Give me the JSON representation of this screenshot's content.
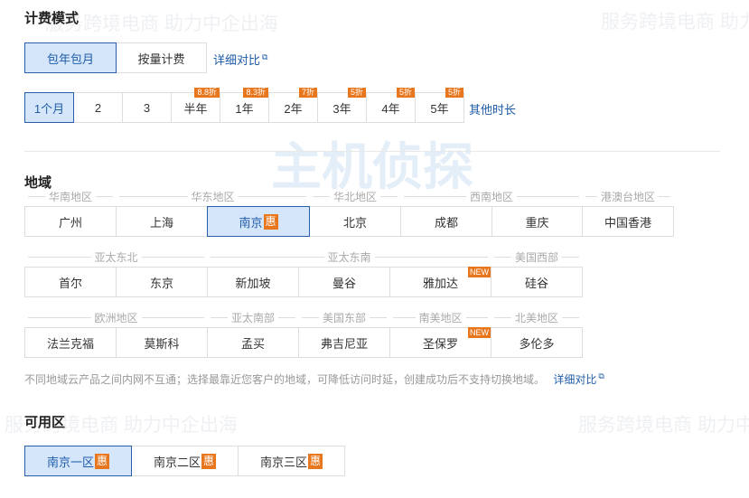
{
  "watermark": {
    "slogan": "服务跨境电商 助力中企出海",
    "logo": "主机侦探"
  },
  "billing": {
    "title": "计费模式",
    "options": [
      "包年包月",
      "按量计费"
    ],
    "selected": 0,
    "compare_link": "详细对比"
  },
  "duration": {
    "options": [
      {
        "label": "1个月"
      },
      {
        "label": "2"
      },
      {
        "label": "3"
      },
      {
        "label": "半年",
        "badge": "8.8折"
      },
      {
        "label": "1年",
        "badge": "8.3折"
      },
      {
        "label": "2年",
        "badge": "7折"
      },
      {
        "label": "3年",
        "badge": "5折"
      },
      {
        "label": "4年",
        "badge": "5折"
      },
      {
        "label": "5年",
        "badge": "5折"
      }
    ],
    "selected": 0,
    "other_link": "其他时长"
  },
  "region": {
    "title": "地域",
    "rows": [
      [
        {
          "group": "华南地区",
          "items": [
            {
              "label": "广州"
            }
          ]
        },
        {
          "group": "华东地区",
          "items": [
            {
              "label": "上海"
            },
            {
              "label": "南京",
              "hui": "惠",
              "selected": true
            }
          ]
        },
        {
          "group": "华北地区",
          "items": [
            {
              "label": "北京"
            }
          ]
        },
        {
          "group": "西南地区",
          "items": [
            {
              "label": "成都"
            },
            {
              "label": "重庆"
            }
          ]
        },
        {
          "group": "港澳台地区",
          "items": [
            {
              "label": "中国香港"
            }
          ]
        }
      ],
      [
        {
          "group": "亚太东北",
          "items": [
            {
              "label": "首尔"
            },
            {
              "label": "东京"
            }
          ]
        },
        {
          "group": "亚太东南",
          "items": [
            {
              "label": "新加坡"
            },
            {
              "label": "曼谷"
            },
            {
              "label": "雅加达",
              "new": "NEW"
            }
          ]
        },
        {
          "group": "美国西部",
          "items": [
            {
              "label": "硅谷"
            }
          ]
        }
      ],
      [
        {
          "group": "欧洲地区",
          "items": [
            {
              "label": "法兰克福"
            },
            {
              "label": "莫斯科"
            }
          ]
        },
        {
          "group": "亚太南部",
          "items": [
            {
              "label": "孟买"
            }
          ]
        },
        {
          "group": "美国东部",
          "items": [
            {
              "label": "弗吉尼亚"
            }
          ]
        },
        {
          "group": "南美地区",
          "items": [
            {
              "label": "圣保罗",
              "new": "NEW"
            }
          ]
        },
        {
          "group": "北美地区",
          "items": [
            {
              "label": "多伦多"
            }
          ]
        }
      ]
    ],
    "note": "不同地域云产品之间内网不互通；选择最靠近您客户的地域，可降低访问时延，创建成功后不支持切换地域。",
    "compare_link": "详细对比"
  },
  "zone": {
    "title": "可用区",
    "options": [
      {
        "label": "南京一区",
        "hui": "惠"
      },
      {
        "label": "南京二区",
        "hui": "惠"
      },
      {
        "label": "南京三区",
        "hui": "惠"
      }
    ],
    "selected": 0
  },
  "icons": {
    "external": "external-link-icon"
  }
}
